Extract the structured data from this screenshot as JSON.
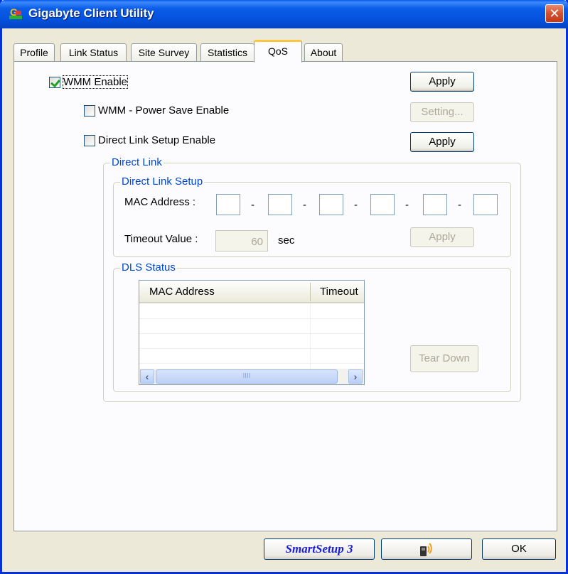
{
  "window": {
    "title": "Gigabyte Client Utility",
    "close_glyph": "✕"
  },
  "tabs": [
    {
      "label": "Profile",
      "active": false
    },
    {
      "label": "Link Status",
      "active": false
    },
    {
      "label": "Site Survey",
      "active": false
    },
    {
      "label": "Statistics",
      "active": false
    },
    {
      "label": "QoS",
      "active": true
    },
    {
      "label": "About",
      "active": false
    }
  ],
  "qos": {
    "wmm_enable": {
      "label": "WMM Enable",
      "checked": true
    },
    "wmm_power_save": {
      "label": "WMM - Power Save Enable",
      "checked": false
    },
    "dls_enable": {
      "label": "Direct Link Setup Enable",
      "checked": false
    },
    "apply_label": "Apply",
    "setting_label": "Setting...",
    "apply2_label": "Apply"
  },
  "direct_link": {
    "group_label": "Direct Link",
    "setup": {
      "group_label": "Direct Link Setup",
      "mac_label": "MAC Address :",
      "separator": "-",
      "timeout_label": "Timeout Value :",
      "timeout_value": "60",
      "timeout_unit": "sec",
      "apply_label": "Apply"
    },
    "status": {
      "group_label": "DLS Status",
      "columns": [
        "MAC Address",
        "Timeout"
      ],
      "rows": [],
      "scroll_grip": "IIII",
      "teardown_label": "Tear Down"
    }
  },
  "footer": {
    "smartsetup_label": "SmartSetup 3",
    "ok_label": "OK"
  }
}
